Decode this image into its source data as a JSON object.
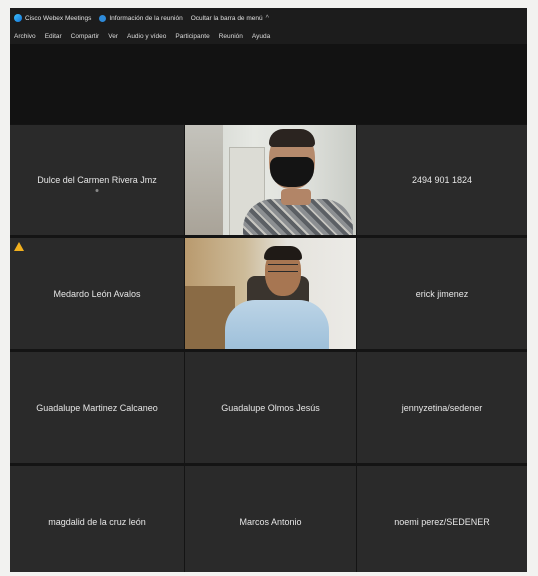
{
  "titlebar": {
    "app_name": "Cisco Webex Meetings",
    "meeting_info": "Información de la reunión",
    "hide_menu": "Ocultar la barra de menú",
    "chevron": "^"
  },
  "menu": {
    "items": [
      "Archivo",
      "Editar",
      "Compartir",
      "Ver",
      "Audio y vídeo",
      "Participante",
      "Reunión",
      "Ayuda"
    ]
  },
  "participants": [
    {
      "name": "Dulce del Carmen Rivera Jmz",
      "video": false
    },
    {
      "name": "",
      "video": true
    },
    {
      "name": "2494 901 1824",
      "video": false
    },
    {
      "name": "Medardo León Avalos",
      "video": false,
      "warning": true
    },
    {
      "name": "",
      "video": true
    },
    {
      "name": "erick jimenez",
      "video": false
    },
    {
      "name": "Guadalupe Martinez Calcaneo",
      "video": false
    },
    {
      "name": "Guadalupe Olmos Jesús",
      "video": false
    },
    {
      "name": "jennyzetina/sedener",
      "video": false
    },
    {
      "name": "magdalid de la cruz león",
      "video": false
    },
    {
      "name": "Marcos Antonio",
      "video": false
    },
    {
      "name": "noemi perez/SEDENER",
      "video": false
    }
  ],
  "icons": {
    "app": "webex-icon",
    "info": "info-icon",
    "warning": "warning-icon"
  },
  "colors": {
    "warning": "#f2b01e",
    "tile_background": "#2a2a2a",
    "window_background": "#141414"
  }
}
